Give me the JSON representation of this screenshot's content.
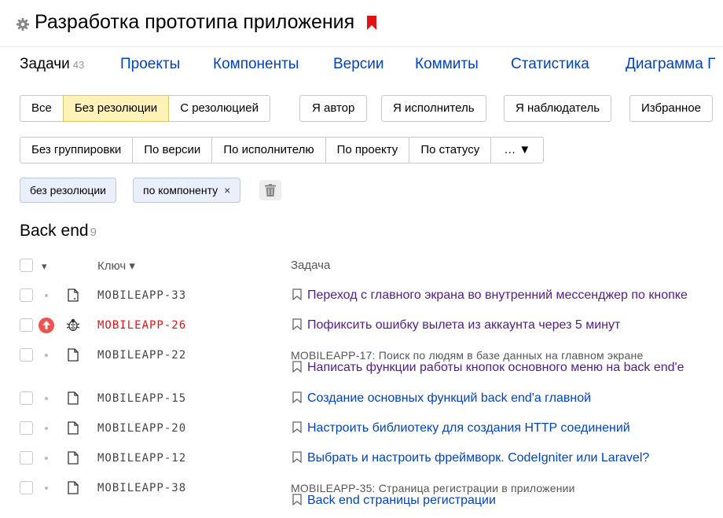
{
  "header": {
    "title": "Разработка прототипа приложения",
    "settings_icon": "gear-icon",
    "bookmark_icon": "bookmark-icon",
    "bookmark_color": "#e31212"
  },
  "tabs": [
    {
      "label": "Задачи",
      "count": "43",
      "active": true
    },
    {
      "label": "Проекты"
    },
    {
      "label": "Компоненты"
    },
    {
      "label": "Версии"
    },
    {
      "label": "Коммиты"
    },
    {
      "label": "Статистика"
    },
    {
      "label": "Диаграмма Г"
    }
  ],
  "resolution_filters": {
    "all": "Все",
    "no_resolution": "Без резолюции",
    "with_resolution": "С резолюцией",
    "selected": "Без резолюции"
  },
  "role_filters": {
    "author": "Я автор",
    "assignee": "Я исполнитель",
    "watcher": "Я наблюдатель",
    "favorites": "Избранное"
  },
  "grouping": {
    "none": "Без группировки",
    "by_version": "По версии",
    "by_assignee": "По исполнителю",
    "by_project": "По проекту",
    "by_status": "По статусу",
    "more": "… ▼"
  },
  "active_filters": {
    "resolution_chip": "без резолюции",
    "component_chip": "по компоненту",
    "remove_glyph": "×"
  },
  "group": {
    "title": "Back end",
    "count": "9"
  },
  "columns": {
    "key": "Ключ ▾",
    "task": "Задача",
    "sort_glyph": "▾"
  },
  "colors": {
    "link": "#0044bb",
    "visited": "#551a8b",
    "priority_high": "#ef5350",
    "selected_filter": "#fff3b8"
  },
  "issues": [
    {
      "key": "MOBILEAPP-33",
      "summary": "Переход с главного экрана во внутренний мессенджер по кнопке",
      "type_icon": "doc-icon",
      "visited": true
    },
    {
      "key": "MOBILEAPP-26",
      "summary": "Пофиксить ошибку вылета из аккаунта через 5 минут",
      "type_icon": "bug-icon",
      "priority_icon": "priority-up-icon",
      "visited": true
    },
    {
      "key": "MOBILEAPP-22",
      "parent": "MOBILEAPP-17: Поиск по людям в базе данных на главном экране",
      "summary": "Написать функции работы кнопок основного меню на back end'е",
      "type_icon": "doc-icon",
      "visited": true
    },
    {
      "key": "MOBILEAPP-15",
      "summary": "Создание основных функций back end'а главной",
      "type_icon": "doc-icon",
      "visited": false
    },
    {
      "key": "MOBILEAPP-20",
      "summary": "Настроить библиотеку для создания HTTP соединений",
      "type_icon": "doc-icon",
      "visited": false
    },
    {
      "key": "MOBILEAPP-12",
      "summary": "Выбрать и настроить фреймворк. CodeIgniter или Laravel?",
      "type_icon": "doc-icon",
      "visited": false
    },
    {
      "key": "MOBILEAPP-38",
      "parent": "MOBILEAPP-35: Страница регистрации в приложении",
      "summary": "Back end страницы регистрации",
      "type_icon": "doc-icon",
      "visited": false
    }
  ]
}
